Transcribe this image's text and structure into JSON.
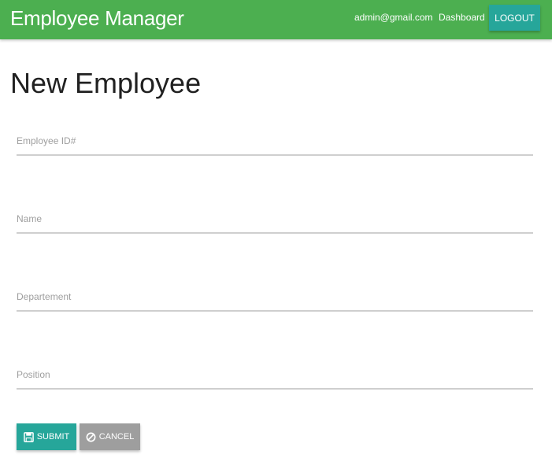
{
  "navbar": {
    "brand": "Employee Manager",
    "user_email": "admin@gmail.com",
    "dashboard_link": "Dashboard",
    "logout_label": "LOGOUT",
    "color": "#4caf50"
  },
  "page": {
    "title": "New Employee"
  },
  "form": {
    "fields": [
      {
        "placeholder": "Employee ID#",
        "value": ""
      },
      {
        "placeholder": "Name",
        "value": ""
      },
      {
        "placeholder": "Departement",
        "value": ""
      },
      {
        "placeholder": "Position",
        "value": ""
      }
    ],
    "submit_label": "SUBMIT",
    "submit_icon": "save-icon",
    "cancel_label": "CANCEL",
    "cancel_icon": "cancel-circle-icon",
    "accent_color": "#26a69a",
    "cancel_color": "#9e9e9e"
  }
}
